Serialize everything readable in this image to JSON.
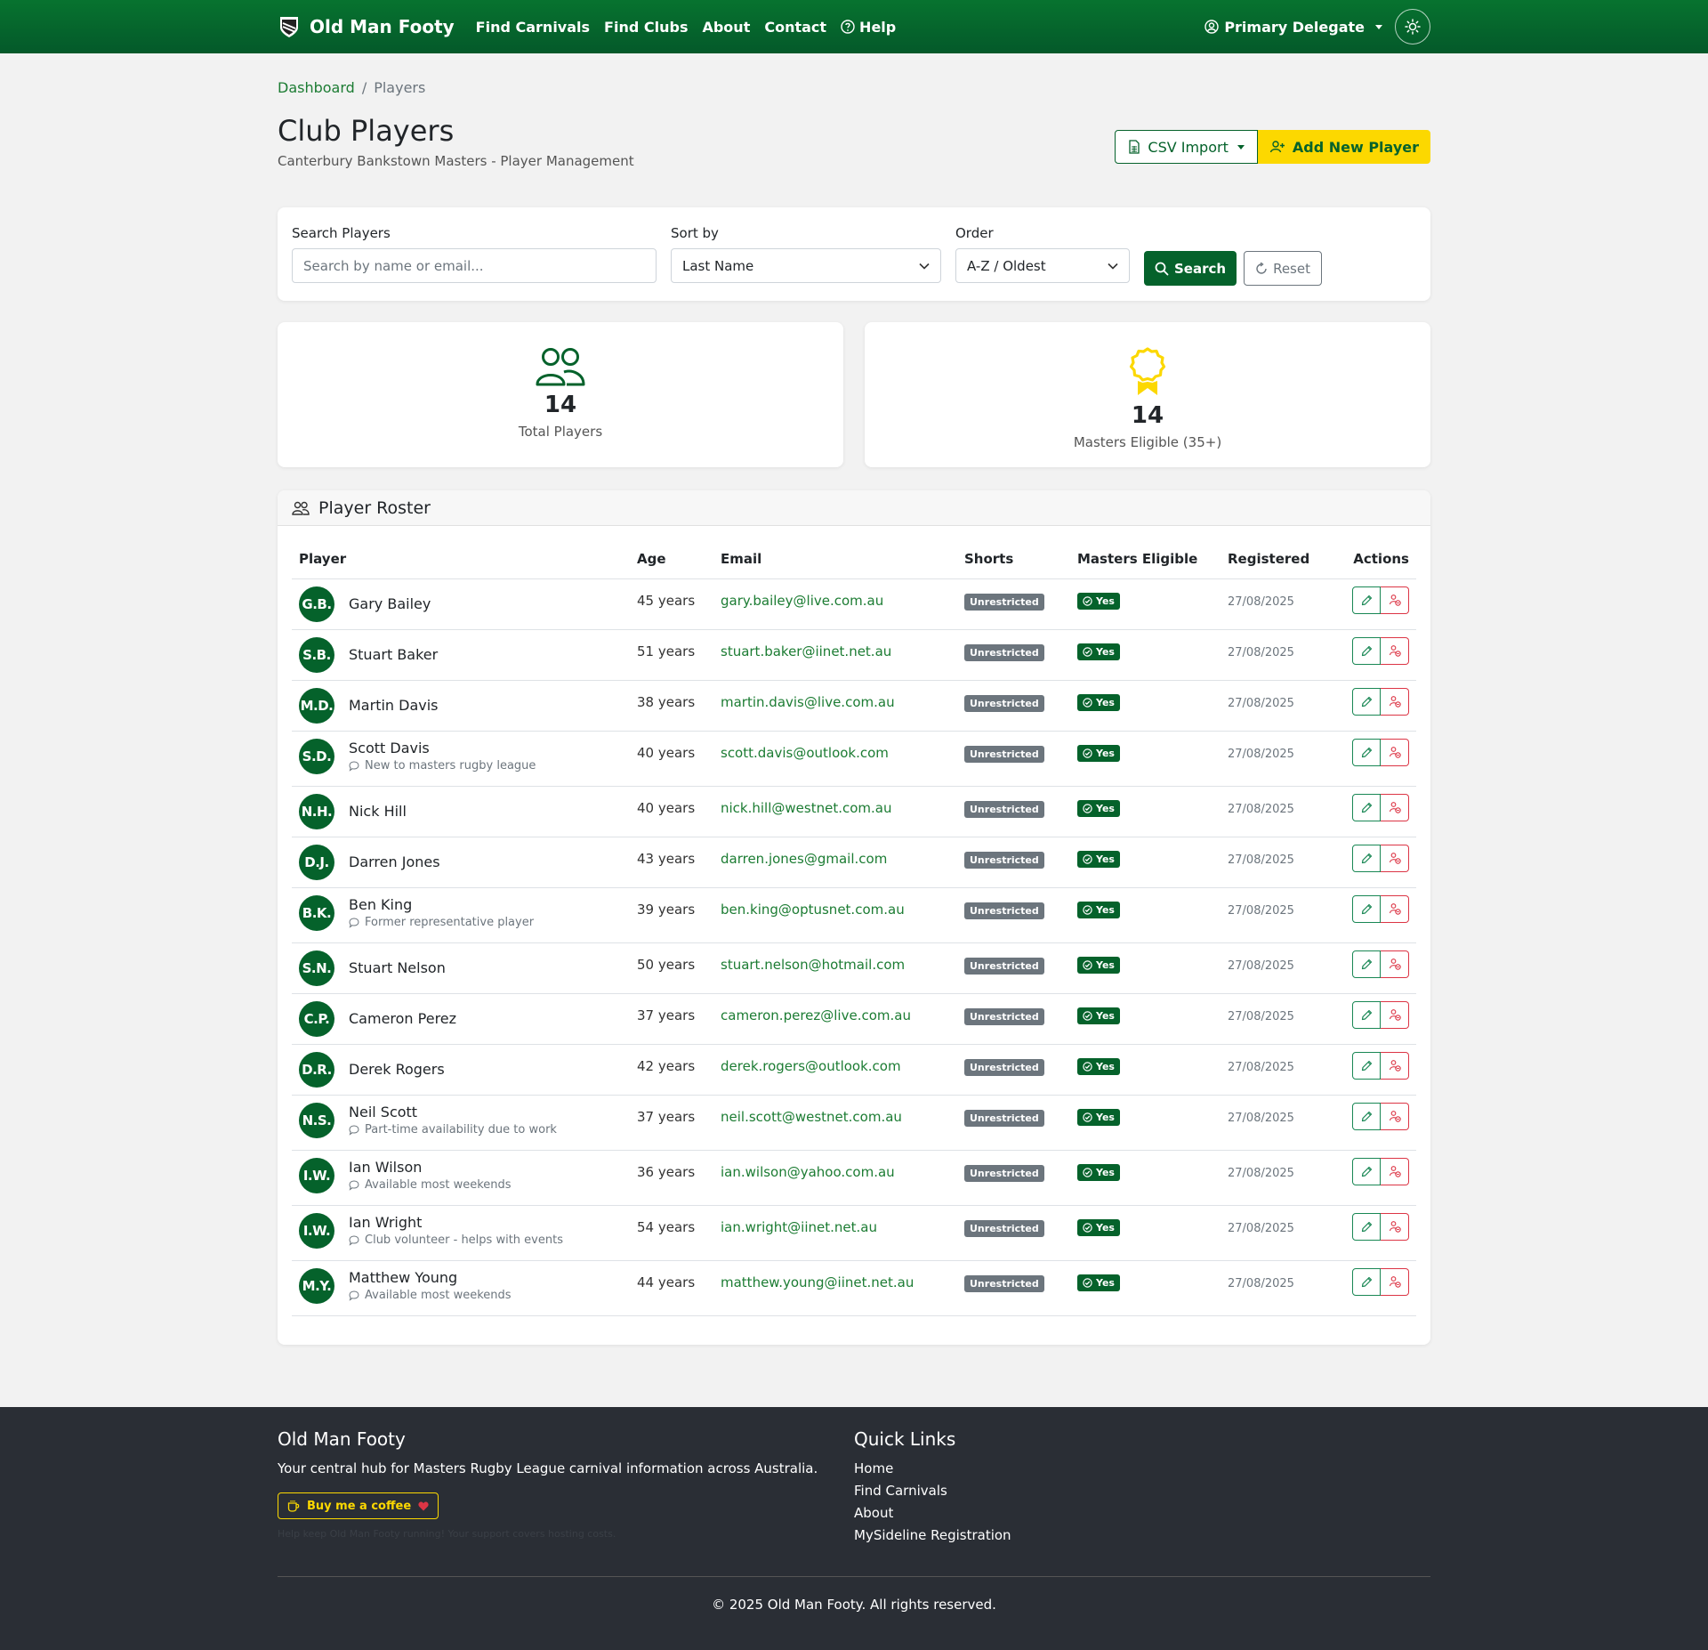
{
  "nav": {
    "brand": "Old Man Footy",
    "links": [
      "Find Carnivals",
      "Find Clubs",
      "About",
      "Contact"
    ],
    "help": "Help",
    "user": "Primary Delegate"
  },
  "breadcrumb": {
    "home": "Dashboard",
    "separator": "/",
    "current": "Players"
  },
  "header": {
    "title": "Club Players",
    "subtitle": "Canterbury Bankstown Masters - Player Management",
    "csv_import": "CSV Import",
    "add_player": "Add New Player"
  },
  "filters": {
    "search_label": "Search Players",
    "search_placeholder": "Search by name or email...",
    "sort_label": "Sort by",
    "sort_value": "Last Name",
    "order_label": "Order",
    "order_value": "A-Z / Oldest",
    "search_button": "Search",
    "reset_button": "Reset"
  },
  "stats": {
    "total_players": "14",
    "total_players_label": "Total Players",
    "masters_eligible": "14",
    "masters_eligible_label": "Masters Eligible (35+)"
  },
  "roster": {
    "title": "Player Roster",
    "columns": [
      "Player",
      "Age",
      "Email",
      "Shorts",
      "Masters Eligible",
      "Registered",
      "Actions"
    ],
    "rows": [
      {
        "initials": "G.B.",
        "name": "Gary Bailey",
        "note": "",
        "age": "45 years",
        "email": "gary.bailey@live.com.au",
        "shorts": "Unrestricted",
        "eligible": "Yes",
        "registered": "27/08/2025"
      },
      {
        "initials": "S.B.",
        "name": "Stuart Baker",
        "note": "",
        "age": "51 years",
        "email": "stuart.baker@iinet.net.au",
        "shorts": "Unrestricted",
        "eligible": "Yes",
        "registered": "27/08/2025"
      },
      {
        "initials": "M.D.",
        "name": "Martin Davis",
        "note": "",
        "age": "38 years",
        "email": "martin.davis@live.com.au",
        "shorts": "Unrestricted",
        "eligible": "Yes",
        "registered": "27/08/2025"
      },
      {
        "initials": "S.D.",
        "name": "Scott Davis",
        "note": "New to masters rugby league",
        "age": "40 years",
        "email": "scott.davis@outlook.com",
        "shorts": "Unrestricted",
        "eligible": "Yes",
        "registered": "27/08/2025"
      },
      {
        "initials": "N.H.",
        "name": "Nick Hill",
        "note": "",
        "age": "40 years",
        "email": "nick.hill@westnet.com.au",
        "shorts": "Unrestricted",
        "eligible": "Yes",
        "registered": "27/08/2025"
      },
      {
        "initials": "D.J.",
        "name": "Darren Jones",
        "note": "",
        "age": "43 years",
        "email": "darren.jones@gmail.com",
        "shorts": "Unrestricted",
        "eligible": "Yes",
        "registered": "27/08/2025"
      },
      {
        "initials": "B.K.",
        "name": "Ben King",
        "note": "Former representative player",
        "age": "39 years",
        "email": "ben.king@optusnet.com.au",
        "shorts": "Unrestricted",
        "eligible": "Yes",
        "registered": "27/08/2025"
      },
      {
        "initials": "S.N.",
        "name": "Stuart Nelson",
        "note": "",
        "age": "50 years",
        "email": "stuart.nelson@hotmail.com",
        "shorts": "Unrestricted",
        "eligible": "Yes",
        "registered": "27/08/2025"
      },
      {
        "initials": "C.P.",
        "name": "Cameron Perez",
        "note": "",
        "age": "37 years",
        "email": "cameron.perez@live.com.au",
        "shorts": "Unrestricted",
        "eligible": "Yes",
        "registered": "27/08/2025"
      },
      {
        "initials": "D.R.",
        "name": "Derek Rogers",
        "note": "",
        "age": "42 years",
        "email": "derek.rogers@outlook.com",
        "shorts": "Unrestricted",
        "eligible": "Yes",
        "registered": "27/08/2025"
      },
      {
        "initials": "N.S.",
        "name": "Neil Scott",
        "note": "Part-time availability due to work",
        "age": "37 years",
        "email": "neil.scott@westnet.com.au",
        "shorts": "Unrestricted",
        "eligible": "Yes",
        "registered": "27/08/2025"
      },
      {
        "initials": "I.W.",
        "name": "Ian Wilson",
        "note": "Available most weekends",
        "age": "36 years",
        "email": "ian.wilson@yahoo.com.au",
        "shorts": "Unrestricted",
        "eligible": "Yes",
        "registered": "27/08/2025"
      },
      {
        "initials": "I.W.",
        "name": "Ian Wright",
        "note": "Club volunteer - helps with events",
        "age": "54 years",
        "email": "ian.wright@iinet.net.au",
        "shorts": "Unrestricted",
        "eligible": "Yes",
        "registered": "27/08/2025"
      },
      {
        "initials": "M.Y.",
        "name": "Matthew Young",
        "note": "Available most weekends",
        "age": "44 years",
        "email": "matthew.young@iinet.net.au",
        "shorts": "Unrestricted",
        "eligible": "Yes",
        "registered": "27/08/2025"
      }
    ]
  },
  "footer": {
    "title": "Old Man Footy",
    "tagline": "Your central hub for Masters Rugby League carnival information across Australia.",
    "coffee": "Buy me a coffee",
    "support_note": "Help keep Old Man Footy running! Your support covers hosting costs.",
    "quick_links_title": "Quick Links",
    "quick_links": [
      "Home",
      "Find Carnivals",
      "About",
      "MySideline Registration"
    ],
    "copyright": "© 2025 Old Man Footy. All rights reserved."
  },
  "colors": {
    "primary": "#05622b",
    "accent": "#fcd800",
    "danger": "#dc3545",
    "footer_bg": "#2a2e35"
  }
}
